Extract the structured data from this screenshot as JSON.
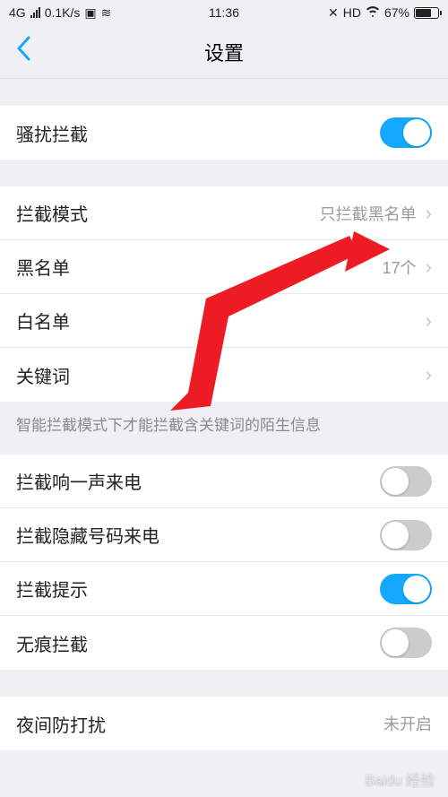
{
  "status": {
    "network": "4G",
    "speed": "0.1K/s",
    "time": "11:36",
    "hd": "HD",
    "battery": "67%"
  },
  "header": {
    "title": "设置"
  },
  "section1": {
    "harassment_block": "骚扰拦截"
  },
  "section2": {
    "block_mode_label": "拦截模式",
    "block_mode_value": "只拦截黑名单",
    "blacklist_label": "黑名单",
    "blacklist_value": "17个",
    "whitelist_label": "白名单",
    "keywords_label": "关键词",
    "hint": "智能拦截模式下才能拦截含关键词的陌生信息"
  },
  "section3": {
    "one_ring_label": "拦截响一声来电",
    "hidden_number_label": "拦截隐藏号码来电",
    "block_tip_label": "拦截提示",
    "traceless_label": "无痕拦截"
  },
  "section4": {
    "night_dnd_label": "夜间防打扰",
    "night_dnd_value": "未开启"
  },
  "colors": {
    "accent": "#14a9ff",
    "arrow": "#ed1b23"
  },
  "watermark": "Baidu 经验"
}
